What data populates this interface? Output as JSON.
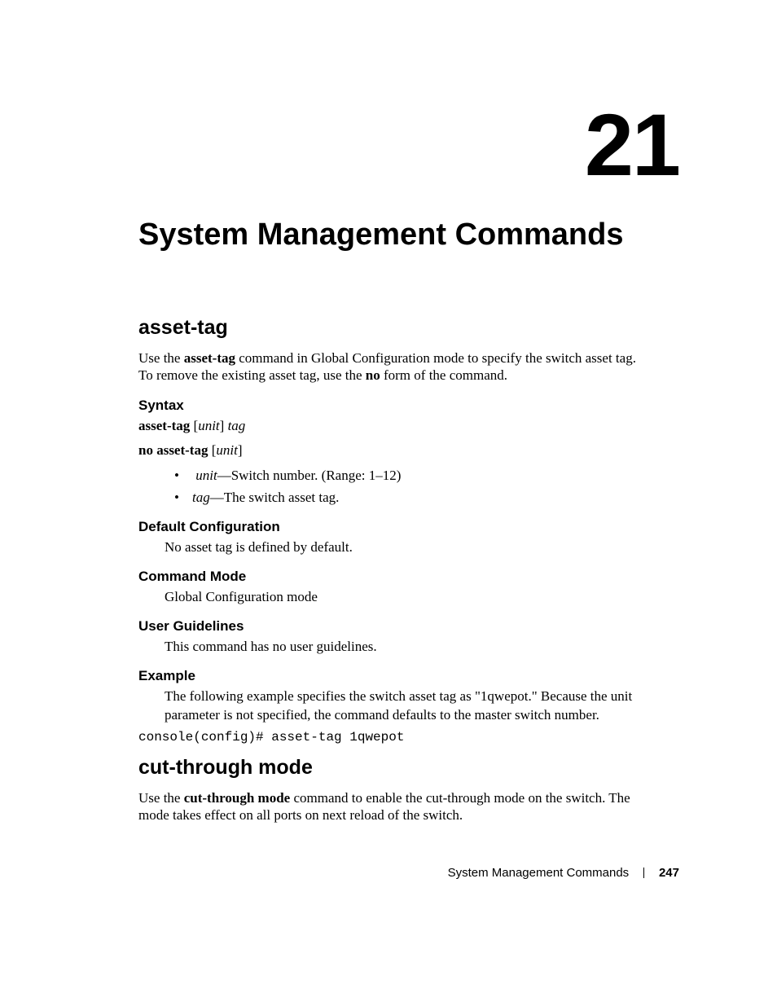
{
  "chapter": {
    "number": "21",
    "title": "System Management Commands"
  },
  "sections": [
    {
      "title": "asset-tag",
      "intro_parts": {
        "p1": "Use the ",
        "bold1": "asset-tag",
        "p2": " command in Global Configuration mode to specify the switch asset tag. To remove the existing asset tag, use the ",
        "bold2": "no",
        "p3": " form of the command."
      },
      "syntax": {
        "heading": "Syntax",
        "line1": {
          "bold": "asset-tag",
          "bracket_open": "  [",
          "italic1": "unit",
          "bracket_close": "] ",
          "italic2": "tag"
        },
        "line2": {
          "bold": "no asset-tag",
          "bracket_open": "  [",
          "italic1": "unit",
          "bracket_close": "]"
        },
        "bullets": [
          {
            "italic": "unit",
            "rest": "—Switch number. (Range: 1–12)"
          },
          {
            "italic": "tag",
            "rest": "—The switch asset tag."
          }
        ]
      },
      "default_config": {
        "heading": "Default Configuration",
        "text": "No asset tag is defined by default."
      },
      "command_mode": {
        "heading": "Command Mode",
        "text": "Global Configuration mode"
      },
      "user_guidelines": {
        "heading": "User Guidelines",
        "text": "This command has no user guidelines."
      },
      "example": {
        "heading": "Example",
        "text": "The following example specifies the switch asset tag as \"1qwepot.\" Because the unit parameter is not specified, the command defaults to the master switch number.",
        "code": "console(config)# asset-tag 1qwepot"
      }
    },
    {
      "title": "cut-through mode",
      "intro_parts": {
        "p1": "Use the ",
        "bold1": "cut-through mode",
        "p2": " command to enable the cut-through mode on the switch. The mode takes effect on all ports on next reload of the switch."
      }
    }
  ],
  "footer": {
    "section_name": "System Management Commands",
    "page_number": "247"
  }
}
